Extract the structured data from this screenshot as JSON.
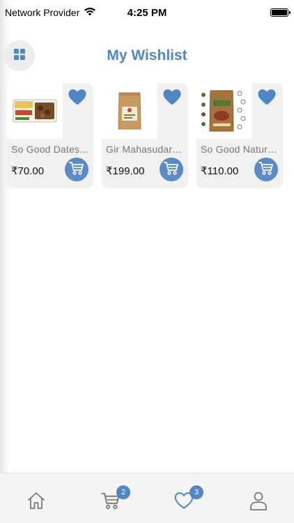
{
  "status_bar": {
    "carrier": "Network Provider",
    "time": "4:25 PM",
    "icons": [
      "wifi-icon",
      "battery-icon"
    ]
  },
  "header": {
    "title": "My Wishlist",
    "menu_icon": "grid-icon"
  },
  "wishlist": {
    "items": [
      {
        "name": "So Good Dates...",
        "price": "₹70.00",
        "image": "dry-fruit-box"
      },
      {
        "name": "Gir Mahasudars...",
        "price": "₹199.00",
        "image": "kraft-pouch"
      },
      {
        "name": "So Good Natural...",
        "price": "₹110.00",
        "image": "brown-pouch-with-icons"
      }
    ]
  },
  "tab_bar": {
    "tabs": [
      {
        "name": "home",
        "icon": "home-icon"
      },
      {
        "name": "cart",
        "icon": "cart-icon",
        "badge": "2"
      },
      {
        "name": "wishlist",
        "icon": "heart-icon",
        "badge": "3"
      },
      {
        "name": "profile",
        "icon": "user-icon"
      }
    ]
  },
  "colors": {
    "accent": "#4f86c6",
    "button": "#5b8ac7",
    "card_bg": "#f1f1ef"
  }
}
